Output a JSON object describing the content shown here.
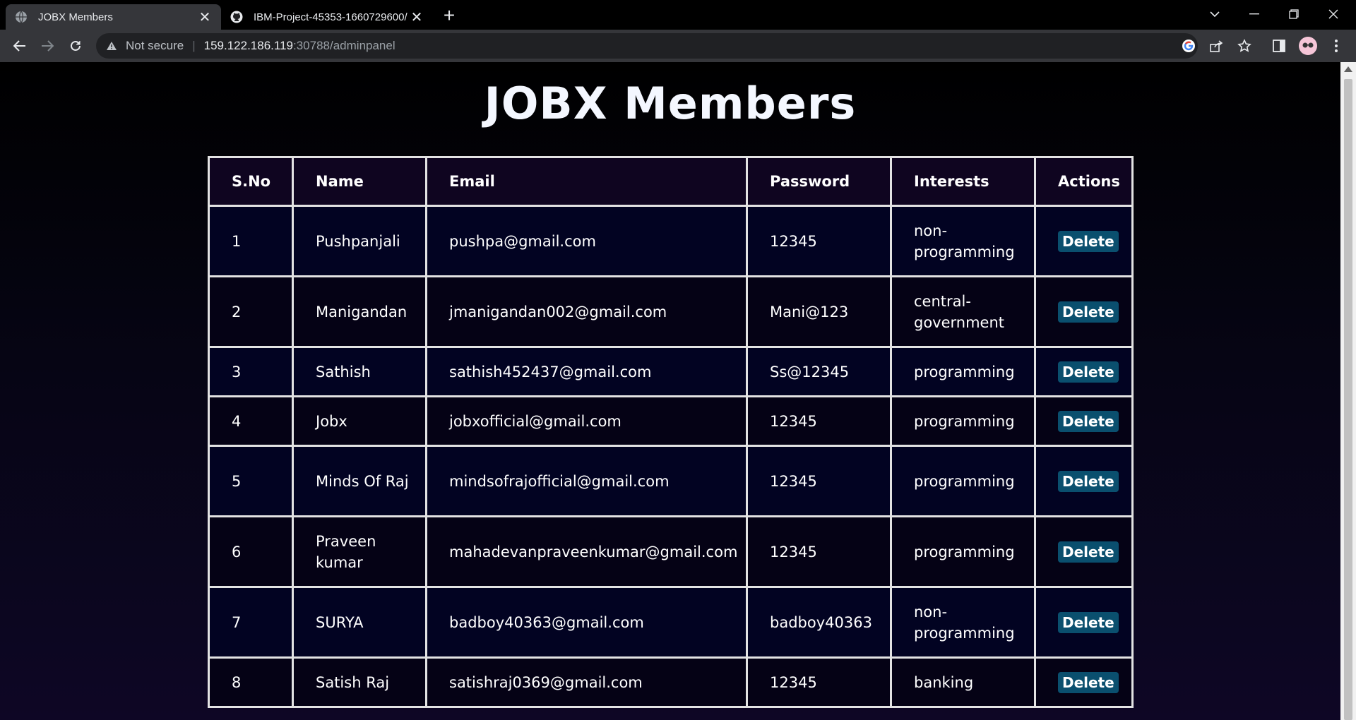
{
  "browser": {
    "tabs": [
      {
        "title": "JOBX Members",
        "icon": "globe-icon",
        "active": true
      },
      {
        "title": "IBM-Project-45353-1660729600/",
        "icon": "github-icon",
        "active": false
      }
    ],
    "address": {
      "security_label": "Not secure",
      "host": "159.122.186.119",
      "path": ":30788/adminpanel"
    }
  },
  "page": {
    "title": "JOBX Members",
    "columns": [
      "S.No",
      "Name",
      "Email",
      "Password",
      "Interests",
      "Actions"
    ],
    "delete_label": "Delete",
    "rows": [
      {
        "sno": "1",
        "name": "Pushpanjali",
        "email": "pushpa@gmail.com",
        "password": "12345",
        "interests": "non-programming"
      },
      {
        "sno": "2",
        "name": "Manigandan",
        "email": "jmanigandan002@gmail.com",
        "password": "Mani@123",
        "interests": "central-government"
      },
      {
        "sno": "3",
        "name": "Sathish",
        "email": "sathish452437@gmail.com",
        "password": "Ss@12345",
        "interests": "programming"
      },
      {
        "sno": "4",
        "name": "Jobx",
        "email": "jobxofficial@gmail.com",
        "password": "12345",
        "interests": "programming"
      },
      {
        "sno": "5",
        "name": "Minds Of Raj",
        "email": "mindsofrajofficial@gmail.com",
        "password": "12345",
        "interests": "programming"
      },
      {
        "sno": "6",
        "name": "Praveen kumar",
        "email": "mahadevanpraveenkumar@gmail.com",
        "password": "12345",
        "interests": "programming"
      },
      {
        "sno": "7",
        "name": "SURYA",
        "email": "badboy40363@gmail.com",
        "password": "badboy40363",
        "interests": "non-programming"
      },
      {
        "sno": "8",
        "name": "Satish Raj",
        "email": "satishraj0369@gmail.com",
        "password": "12345",
        "interests": "banking"
      }
    ]
  },
  "colors": {
    "delete_button": "#0a4f6e",
    "table_border": "#e3e3e3",
    "header_bg": "#0f0520"
  }
}
